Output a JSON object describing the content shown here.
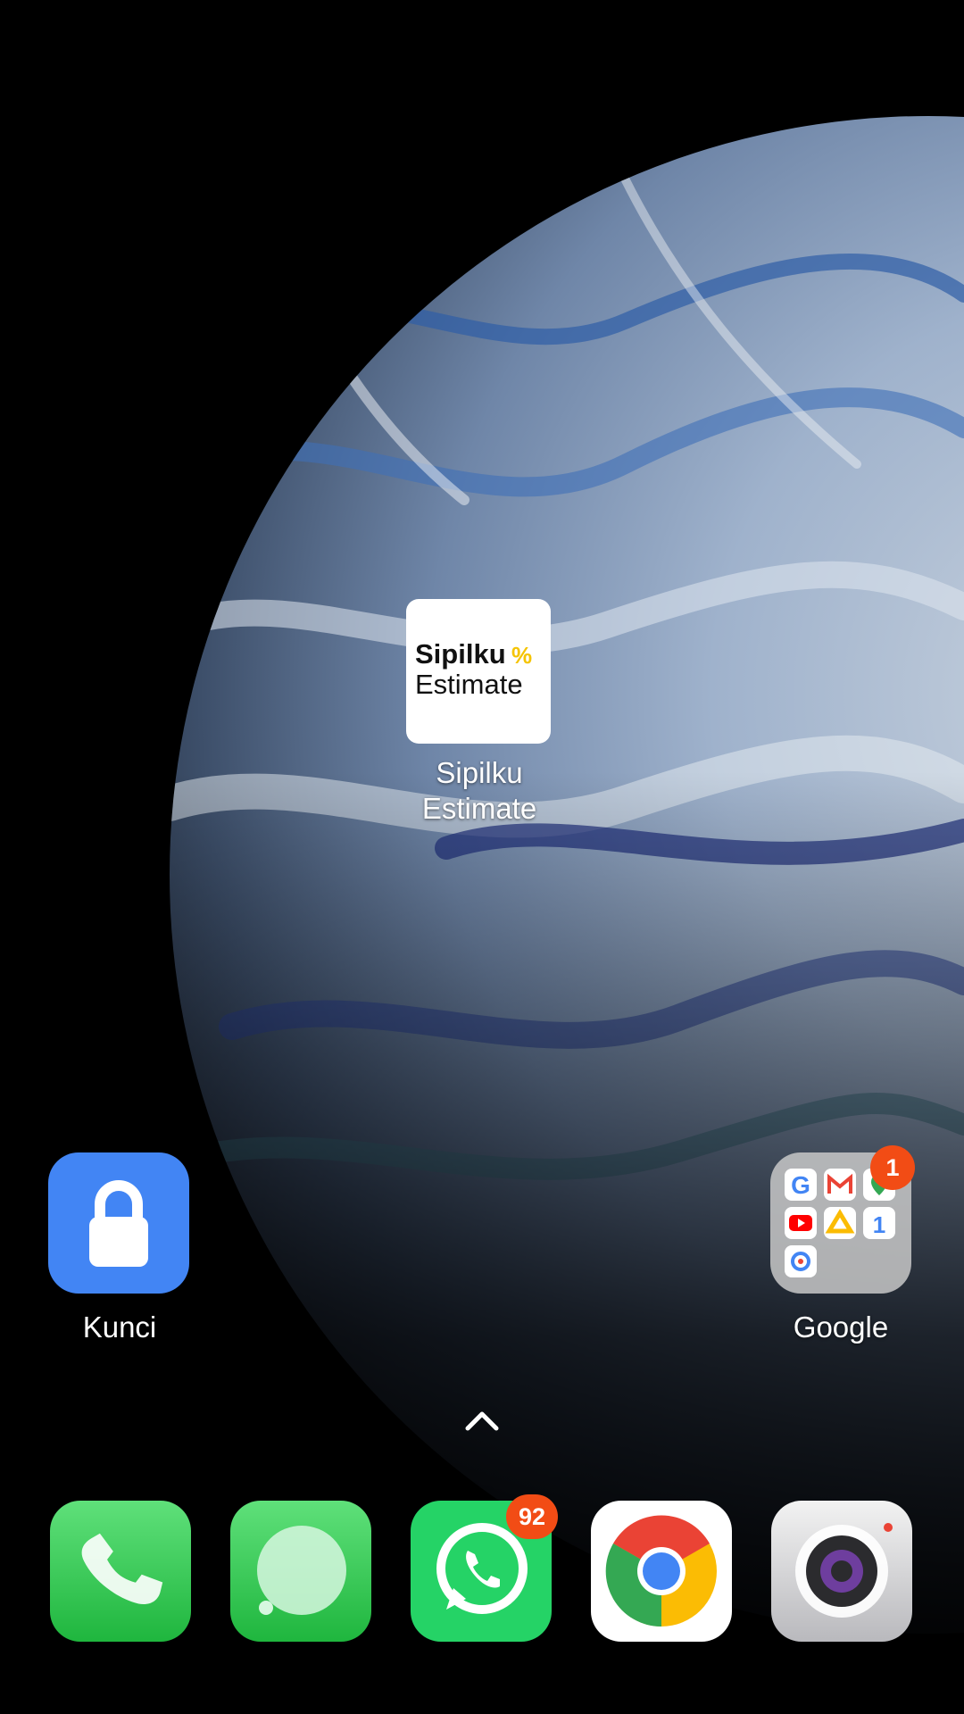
{
  "home": {
    "apps": [
      {
        "name": "Sipilku\nEstimate",
        "label_line1": "Sipilku",
        "label_line2": "Estimate",
        "icon": "sipilku-estimate-icon",
        "icon_text_line1": "Sipilku",
        "icon_text_line2": "Estimate"
      },
      {
        "label": "Kunci",
        "icon": "lock-icon",
        "color": "#4285f4"
      },
      {
        "label": "Google",
        "icon": "google-folder-icon",
        "badge": "1"
      }
    ]
  },
  "gesture": {
    "icon": "chevron-up-icon"
  },
  "dock": {
    "apps": [
      {
        "icon": "phone-icon",
        "color": "#34c759"
      },
      {
        "icon": "messages-icon",
        "color": "#34c759"
      },
      {
        "icon": "whatsapp-icon",
        "color": "#25d366",
        "badge": "92"
      },
      {
        "icon": "chrome-icon"
      },
      {
        "icon": "camera-icon"
      }
    ]
  },
  "colors": {
    "badge": "#f24c15",
    "accent_yellow": "#f5c400"
  }
}
